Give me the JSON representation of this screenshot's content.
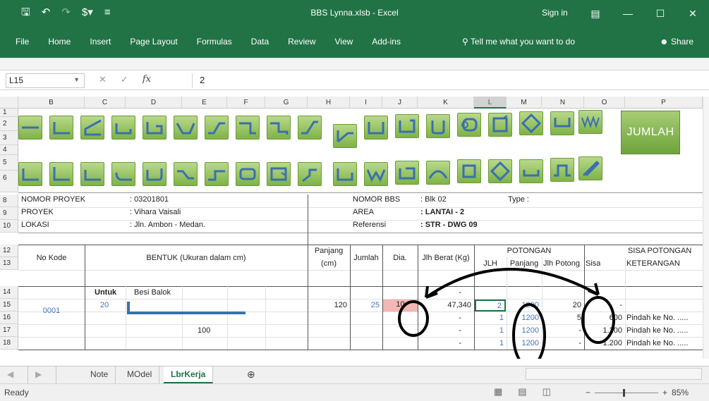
{
  "window": {
    "title": "BBS Lynna.xlsb - Excel",
    "sign_in": "Sign in"
  },
  "ribbon": {
    "tabs": [
      "File",
      "Home",
      "Insert",
      "Page Layout",
      "Formulas",
      "Data",
      "Review",
      "View",
      "Add-ins"
    ],
    "tell_me": "Tell me what you want to do",
    "share": "Share"
  },
  "formula_bar": {
    "name_box": "L15",
    "fx": "fx",
    "value": "2"
  },
  "columns": [
    "B",
    "C",
    "D",
    "E",
    "F",
    "G",
    "H",
    "I",
    "J",
    "K",
    "L",
    "M",
    "N",
    "O",
    "P"
  ],
  "rows": [
    "1",
    "2",
    "3",
    "4",
    "5",
    "6",
    "8",
    "9",
    "10",
    "12",
    "13",
    "14",
    "15",
    "16",
    "17",
    "18"
  ],
  "jumlah_button": "JUMLAH",
  "info": {
    "nomor_proyek_label": "NOMOR PROYEK",
    "nomor_proyek_value": ": 03201801",
    "proyek_label": "PROYEK",
    "proyek_value": ": Vihara Vaisali",
    "lokasi_label": "LOKASI",
    "lokasi_value": ": Jln. Ambon - Medan.",
    "nomor_bbs_label": "NOMOR BBS",
    "nomor_bbs_value": ": Blk 02",
    "area_label": "AREA",
    "area_value": ": LANTAI - 2",
    "referensi_label": "Referensi",
    "referensi_value": ": STR - DWG 09",
    "type_label": "Type :"
  },
  "table_header": {
    "no_kode": "No Kode",
    "bentuk": "BENTUK (Ukuran dalam cm)",
    "panjang": "Panjang",
    "cm": "(cm)",
    "jumlah": "Jumlah",
    "dia": "Dia.",
    "jlh_berat": "Jlh Berat (Kg)",
    "potongan": "POTONGAN",
    "jlh": "JLH",
    "panjang2": "Panjang",
    "jlh_potong": "Jlh Potong",
    "sisa_potongan": "SISA POTONGAN",
    "sisa": "Sisa",
    "keterangan": "KETERANGAN"
  },
  "body": {
    "kode": "0001",
    "untuk_label": "Untuk",
    "untuk_value": "20",
    "besi_balok": "Besi Balok",
    "dim_100": "100",
    "r14_dash": "-",
    "r15": {
      "panjang": "120",
      "jumlah": "25",
      "dia": "10",
      "berat": "47,340",
      "jlh": "2",
      "panjang2": "1200",
      "jlh_potong": "20",
      "sisa": "-"
    },
    "r16": {
      "berat": "-",
      "jlh": "1",
      "panjang2": "1200",
      "jlh_potong": "5",
      "sisa": "600",
      "ket": "Pindah ke No. ....."
    },
    "r17": {
      "berat": "-",
      "jlh": "1",
      "panjang2": "1200",
      "jlh_potong": "-",
      "sisa": "1.200",
      "ket": "Pindah ke No. ....."
    },
    "r18": {
      "berat": "-",
      "jlh": "1",
      "panjang2": "1200",
      "jlh_potong": "-",
      "sisa": "1.200",
      "ket": "Pindah ke No. ....."
    }
  },
  "sheet_tabs": [
    "Note",
    "MOdel",
    "LbrKerja"
  ],
  "status": {
    "ready": "Ready",
    "zoom": "85%"
  },
  "colors": {
    "excel_green": "#217346",
    "button_green": "#7fb347",
    "highlight_red": "#f4b6b6",
    "value_blue": "#4472c4"
  }
}
